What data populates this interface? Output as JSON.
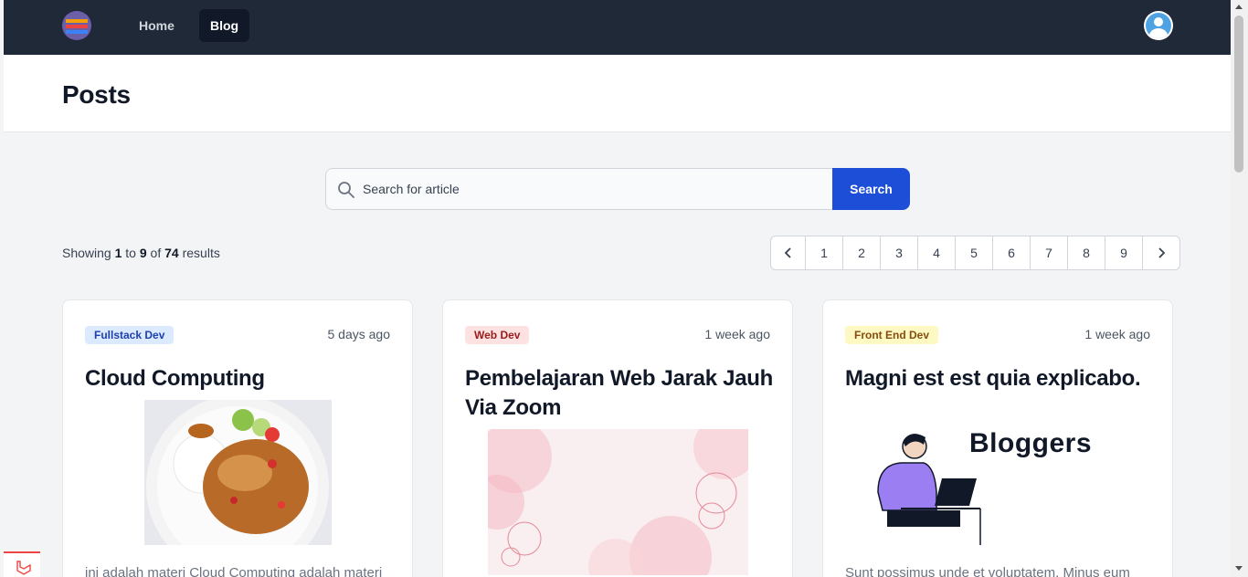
{
  "nav": {
    "logo_icon": "stacked-books-logo-icon",
    "items": [
      {
        "label": "Home",
        "active": false
      },
      {
        "label": "Blog",
        "active": true
      }
    ],
    "avatar_icon": "user-avatar-icon"
  },
  "header": {
    "title": "Posts"
  },
  "search": {
    "placeholder": "Search for article",
    "value": "",
    "button_label": "Search"
  },
  "results": {
    "prefix": "Showing",
    "from": "1",
    "to_word": "to",
    "to": "9",
    "of_word": "of",
    "total": "74",
    "suffix": "results"
  },
  "pagination": {
    "pages": [
      "1",
      "2",
      "3",
      "4",
      "5",
      "6",
      "7",
      "8",
      "9"
    ],
    "prev_icon": "chevron-left-icon",
    "next_icon": "chevron-right-icon"
  },
  "posts": [
    {
      "category": "Fullstack Dev",
      "date": "5 days ago",
      "title": "Cloud Computing",
      "excerpt": "ini adalah materi Cloud Computing adalah materi",
      "image": "food-plate-image"
    },
    {
      "category": "Web Dev",
      "date": "1 week ago",
      "title": "Pembelajaran Web Jarak Jauh Via Zoom",
      "excerpt": "",
      "image": "pink-floral-image"
    },
    {
      "category": "Front End Dev",
      "date": "1 week ago",
      "title": "Magni est est quia explicabo.",
      "excerpt": "Sunt possimus unde et voluptatem. Minus eum",
      "image": "bloggers-illustration-image",
      "image_text": "Bloggers"
    }
  ],
  "colors": {
    "nav_bg": "#1f2937",
    "primary": "#1d4ed8",
    "page_bg": "#f3f4f6"
  }
}
